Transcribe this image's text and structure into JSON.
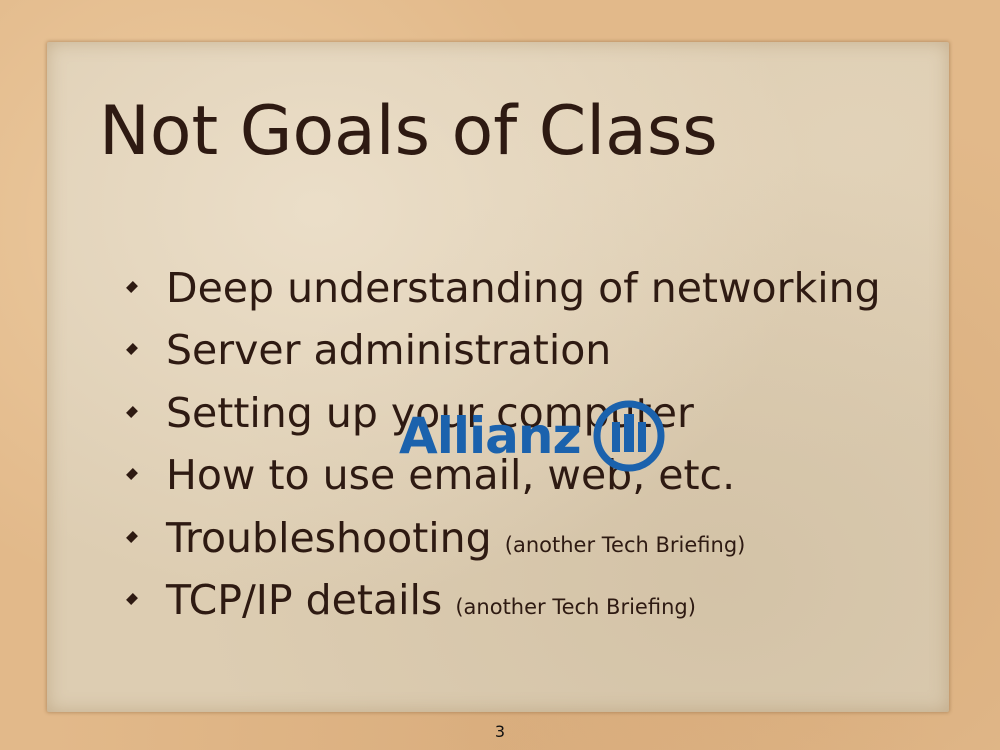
{
  "slide": {
    "title": "Not Goals of Class",
    "bullets": [
      {
        "text": "Deep understanding of networking",
        "note": ""
      },
      {
        "text": "Server administration",
        "note": ""
      },
      {
        "text": "Setting up your computer",
        "note": ""
      },
      {
        "text": "How to use email, web, etc.",
        "note": ""
      },
      {
        "text": "Troubleshooting",
        "note": "(another Tech Briefing)"
      },
      {
        "text": "TCP/IP details",
        "note": "(another Tech Briefing)"
      }
    ],
    "page_number": "3"
  },
  "watermark": {
    "logo_text": "Allianz",
    "color": "#1b62ad"
  },
  "colors": {
    "text": "#2e1a12",
    "paper": "#ddcdb2",
    "background": "#e2b98a"
  }
}
